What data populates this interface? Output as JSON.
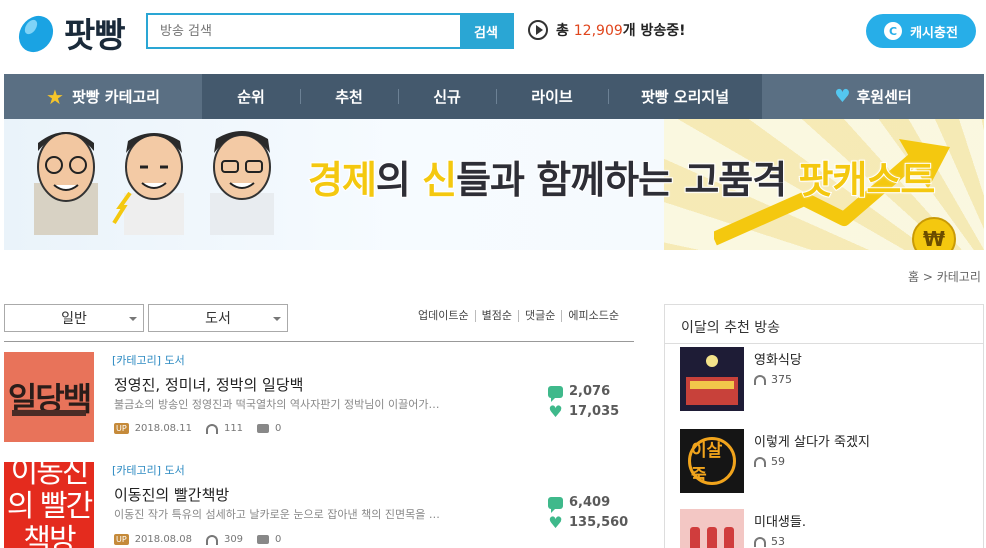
{
  "header": {
    "logo_text": "팟빵",
    "search_placeholder": "방송 검색",
    "search_button": "검색",
    "onair_prefix": "총",
    "onair_count": "12,909",
    "onair_suffix": "개 방송중!",
    "cash_label": "캐시충전",
    "cash_icon_letter": "C"
  },
  "nav": {
    "category_label": "팟빵 카테고리",
    "items": [
      "순위",
      "추천",
      "신규",
      "라이브",
      "팟빵 오리지널"
    ],
    "support_label": "후원센터"
  },
  "banner": {
    "title_pre": "경제",
    "title_mid1": "의 ",
    "title_y2": "신",
    "title_post": "들과 함께하는 고품격 ",
    "title_end": "팟캐스트",
    "coin_symbol": "₩"
  },
  "breadcrumb": "홈 > 카테고리",
  "filters": {
    "select1": "일반",
    "select2": "도서",
    "sorts": [
      "업데이트순",
      "별점순",
      "댓글순",
      "에피소드순"
    ]
  },
  "list": [
    {
      "category": "[카테고리] 도서",
      "title": "정영진, 정미녀, 정박의 일당백",
      "description": "불금쇼의 방송인 정영진과 떡국열차의 역사자판기 정박님이 이끌어가…",
      "up": "UP",
      "date": "2018.08.11",
      "listens": "111",
      "comments": "0",
      "stat_comments": "2,076",
      "stat_likes": "17,035",
      "thumb_text": "일당백"
    },
    {
      "category": "[카테고리] 도서",
      "title": "이동진의 빨간책방",
      "description": "이동진 작가 특유의 섬세하고 날카로운 눈으로 잡아낸 책의 진면목을 …",
      "up": "UP",
      "date": "2018.08.08",
      "listens": "309",
      "comments": "0",
      "stat_comments": "6,409",
      "stat_likes": "135,560",
      "thumb_text": "이동진의 빨간책방"
    }
  ],
  "sidebar": {
    "title": "이달의 추천 방송",
    "items": [
      {
        "name": "영화식당",
        "count": "375"
      },
      {
        "name": "이렇게 살다가 죽겠지",
        "count": "59",
        "thumb_text": "이살죽"
      },
      {
        "name": "미대생들.",
        "count": "53"
      }
    ]
  },
  "colors": {
    "accent": "#2aa6d4",
    "nav_bg": "#44596d",
    "count_red": "#e0451c",
    "stat_green": "#3fb98b"
  }
}
